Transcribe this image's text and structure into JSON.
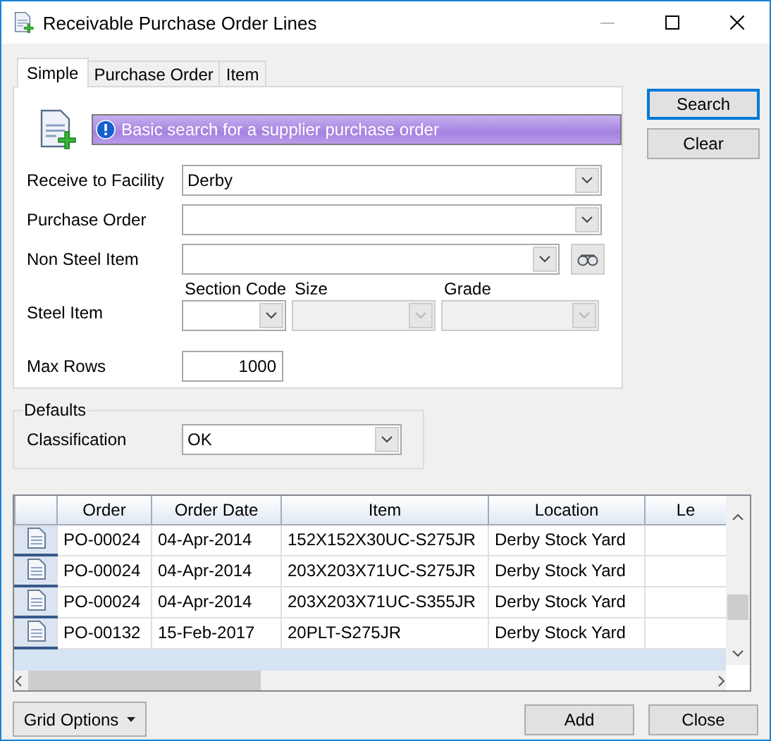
{
  "window": {
    "title": "Receivable Purchase Order Lines"
  },
  "tabs": [
    {
      "label": "Simple",
      "selected": true
    },
    {
      "label": "Purchase Order",
      "selected": false
    },
    {
      "label": "Item",
      "selected": false
    }
  ],
  "banner": {
    "text": "Basic search for a supplier purchase order"
  },
  "fields": [
    {
      "kind": "combo",
      "label": "Receive to Facility",
      "value": "Derby"
    },
    {
      "kind": "combo",
      "label": "Purchase Order"
    },
    {
      "kind": "lookup",
      "label": "Non Steel Item"
    },
    {
      "kind": "steel",
      "label": "Steel Item",
      "parts": [
        {
          "label": "Section Code",
          "disabled": false
        },
        {
          "label": "Size",
          "disabled": true
        },
        {
          "label": "Grade",
          "disabled": true
        }
      ]
    },
    {
      "kind": "number",
      "label": "Max Rows",
      "value": "1000"
    }
  ],
  "side_buttons": [
    {
      "label": "Search",
      "focused": true
    },
    {
      "label": "Clear",
      "focused": false
    }
  ],
  "defaults": {
    "title": "Defaults",
    "label": "Classification",
    "value": "OK"
  },
  "grid": {
    "columns": [
      "Order",
      "Order Date",
      "Item",
      "Location",
      "Le"
    ],
    "rows": [
      [
        "PO-00024",
        "04-Apr-2014",
        "152X152X30UC-S275JR",
        "Derby Stock Yard",
        ""
      ],
      [
        "PO-00024",
        "04-Apr-2014",
        "203X203X71UC-S275JR",
        "Derby Stock Yard",
        ""
      ],
      [
        "PO-00024",
        "04-Apr-2014",
        "203X203X71UC-S355JR",
        "Derby Stock Yard",
        ""
      ],
      [
        "PO-00132",
        "15-Feb-2017",
        "20PLT-S275JR",
        "Derby Stock Yard",
        ""
      ]
    ]
  },
  "footer": {
    "menu_button": "Grid Options",
    "buttons": [
      "Add",
      "Close"
    ]
  }
}
